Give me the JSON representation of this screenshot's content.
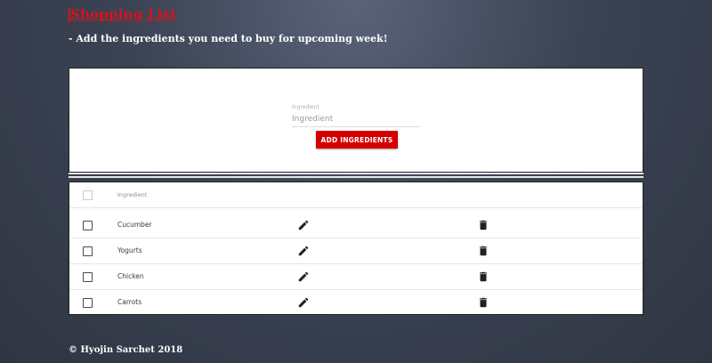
{
  "header": {
    "title": "Shopping List",
    "subtitle": "- Add the ingredients you need to buy for upcoming week!"
  },
  "form": {
    "field_label": "Ingredient",
    "field_placeholder": "Ingredient",
    "field_value": "",
    "add_button_label": "ADD INGREDIENTS"
  },
  "table": {
    "header_label": "Ingredient",
    "rows": [
      {
        "name": "Cucumber",
        "checked": false
      },
      {
        "name": "Yogurts",
        "checked": false
      },
      {
        "name": "Chicken",
        "checked": false
      },
      {
        "name": "Carrots",
        "checked": false
      }
    ],
    "edit_icon": "pencil-icon",
    "delete_icon": "trash-icon"
  },
  "footer": {
    "text": "© Hyojin Sarchet 2018"
  },
  "colors": {
    "accent": "#d40000",
    "background": "#3b4354"
  }
}
